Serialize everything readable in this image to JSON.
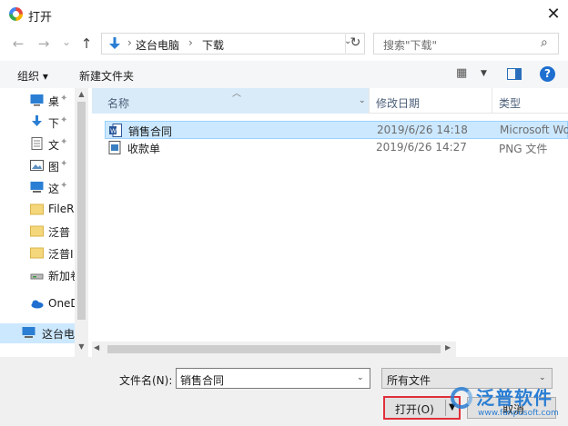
{
  "window": {
    "title": "打开",
    "close_glyph": "✕"
  },
  "address": {
    "back_glyph": "←",
    "forward_glyph": "→",
    "recent_glyph": "⌄",
    "up_glyph": "↑",
    "breadcrumb": [
      "这台电脑",
      "下载"
    ],
    "separator": "›",
    "refresh_glyph": "↻"
  },
  "search": {
    "placeholder": "搜索\"下载\"",
    "icon": "search-icon"
  },
  "toolbar": {
    "organize_label": "组织 ▾",
    "new_folder_label": "新建文件夹",
    "view_icon_glyph": "▦",
    "help_glyph": "?"
  },
  "nav": {
    "items": [
      {
        "label": "桌",
        "icon": "desktop-icon",
        "pinned": true
      },
      {
        "label": "下",
        "icon": "download-arrow-icon",
        "pinned": true
      },
      {
        "label": "文",
        "icon": "document-icon",
        "pinned": true
      },
      {
        "label": "图",
        "icon": "picture-icon",
        "pinned": true
      },
      {
        "label": "这",
        "icon": "computer-icon",
        "pinned": true
      },
      {
        "label": "FileR",
        "icon": "folder-icon",
        "pinned": false
      },
      {
        "label": "泛普",
        "icon": "folder-icon",
        "pinned": false
      },
      {
        "label": "泛普I",
        "icon": "folder-icon",
        "pinned": false
      },
      {
        "label": "新加卷",
        "icon": "drive-icon",
        "pinned": false
      },
      {
        "label": "OneD",
        "icon": "onedrive-icon",
        "pinned": false
      },
      {
        "label": "这台电",
        "icon": "computer-icon",
        "pinned": false
      }
    ],
    "pin_glyph": "📌"
  },
  "list": {
    "columns": {
      "name": "名称",
      "date": "修改日期",
      "type": "类型"
    },
    "rows": [
      {
        "name": "销售合同",
        "date": "2019/6/26 14:18",
        "type": "Microsoft Wo",
        "icon": "word-document-icon",
        "selected": true
      },
      {
        "name": "收款单",
        "date": "2019/6/26 14:27",
        "type": "PNG 文件",
        "icon": "image-file-icon",
        "selected": false
      }
    ]
  },
  "footer": {
    "filename_label": "文件名(N):",
    "filename_value": "销售合同",
    "filter_value": "所有文件",
    "open_label": "打开(O)",
    "cancel_label": "取消"
  },
  "watermark": {
    "text": "泛普软件",
    "url": "www.fanpusoft.com"
  },
  "colors": {
    "selection": "#cce8ff",
    "accent": "#1e6fd0",
    "highlight_border": "#e0303a"
  }
}
